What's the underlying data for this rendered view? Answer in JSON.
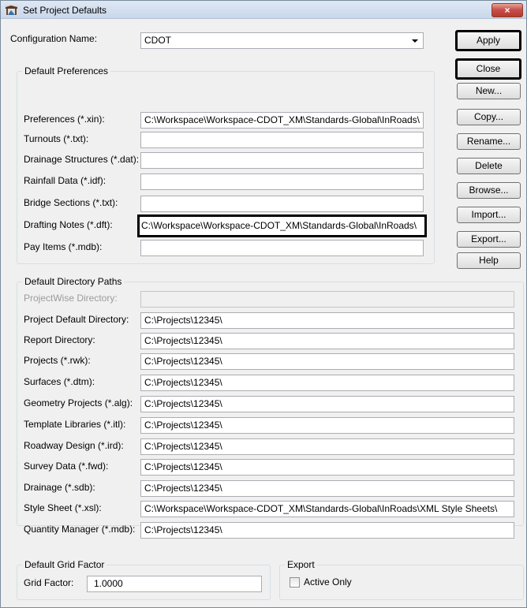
{
  "window": {
    "title": "Set Project Defaults",
    "close_glyph": "×",
    "app_icon": "inroads-app-icon"
  },
  "configuration": {
    "label": "Configuration Name:",
    "value": "CDOT"
  },
  "buttons": {
    "apply": "Apply",
    "close": "Close",
    "new": "New...",
    "copy": "Copy...",
    "rename": "Rename...",
    "delete": "Delete",
    "browse": "Browse...",
    "import": "Import...",
    "export": "Export...",
    "help": "Help"
  },
  "preferences": {
    "title": "Default Preferences",
    "rows": [
      {
        "label": "Preferences (*.xin):",
        "value": "C:\\Workspace\\Workspace-CDOT_XM\\Standards-Global\\InRoads\\"
      },
      {
        "label": "Turnouts (*.txt):",
        "value": ""
      },
      {
        "label": "Drainage Structures (*.dat):",
        "value": ""
      },
      {
        "label": "Rainfall Data (*.idf):",
        "value": ""
      },
      {
        "label": "Bridge Sections (*.txt):",
        "value": ""
      },
      {
        "label": "Drafting Notes (*.dft):",
        "value": "C:\\Workspace\\Workspace-CDOT_XM\\Standards-Global\\InRoads\\"
      },
      {
        "label": "Pay Items (*.mdb):",
        "value": ""
      }
    ]
  },
  "directories": {
    "title": "Default Directory Paths",
    "rows": [
      {
        "label": "ProjectWise Directory:",
        "value": ""
      },
      {
        "label": "Project Default Directory:",
        "value": "C:\\Projects\\12345\\"
      },
      {
        "label": "Report Directory:",
        "value": "C:\\Projects\\12345\\"
      },
      {
        "label": "Projects (*.rwk):",
        "value": "C:\\Projects\\12345\\"
      },
      {
        "label": "Surfaces (*.dtm):",
        "value": "C:\\Projects\\12345\\"
      },
      {
        "label": "Geometry Projects (*.alg):",
        "value": "C:\\Projects\\12345\\"
      },
      {
        "label": "Template Libraries (*.itl):",
        "value": "C:\\Projects\\12345\\"
      },
      {
        "label": "Roadway Design (*.ird):",
        "value": "C:\\Projects\\12345\\"
      },
      {
        "label": "Survey Data (*.fwd):",
        "value": "C:\\Projects\\12345\\"
      },
      {
        "label": "Drainage (*.sdb):",
        "value": "C:\\Projects\\12345\\"
      },
      {
        "label": "Style Sheet (*.xsl):",
        "value": "C:\\Workspace\\Workspace-CDOT_XM\\Standards-Global\\InRoads\\XML Style Sheets\\"
      },
      {
        "label": "Quantity Manager (*.mdb):",
        "value": "C:\\Projects\\12345\\"
      }
    ]
  },
  "grid": {
    "title": "Default Grid Factor",
    "label": "Grid Factor:",
    "value": "1.0000"
  },
  "export": {
    "title": "Export",
    "active_only_label": "Active Only",
    "active_only_checked": false
  }
}
